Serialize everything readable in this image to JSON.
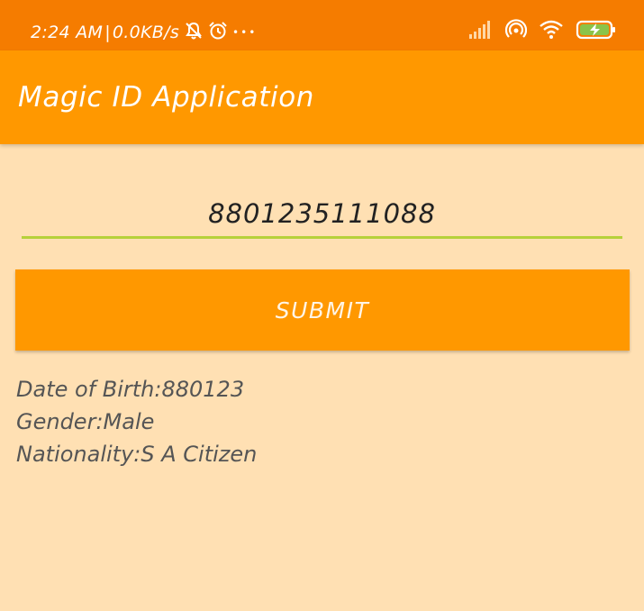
{
  "status_bar": {
    "time": "2:24 AM",
    "separator": "|",
    "network_speed": "0.0KB/s",
    "icons": [
      "notifications-off-icon",
      "alarm-icon",
      "more-dots-icon",
      "signal-icon",
      "hotspot-icon",
      "wifi-icon",
      "battery-charging-icon"
    ],
    "more_glyph": "•••"
  },
  "app_bar": {
    "title": "Magic ID Application"
  },
  "form": {
    "id_number_value": "8801235111088",
    "submit_label": "SUBMIT"
  },
  "results": {
    "date_of_birth_label": "Date of Birth:",
    "date_of_birth_value": "880123",
    "gender_label": "Gender:",
    "gender_value": "Male",
    "nationality_label": "Nationality:",
    "nationality_value": "S A Citizen"
  },
  "colors": {
    "status_bar": "#f57c00",
    "app_bar": "#ff9800",
    "background": "#ffe0b3",
    "input_underline": "#b6d13a",
    "battery_fill": "#8bc34a"
  }
}
